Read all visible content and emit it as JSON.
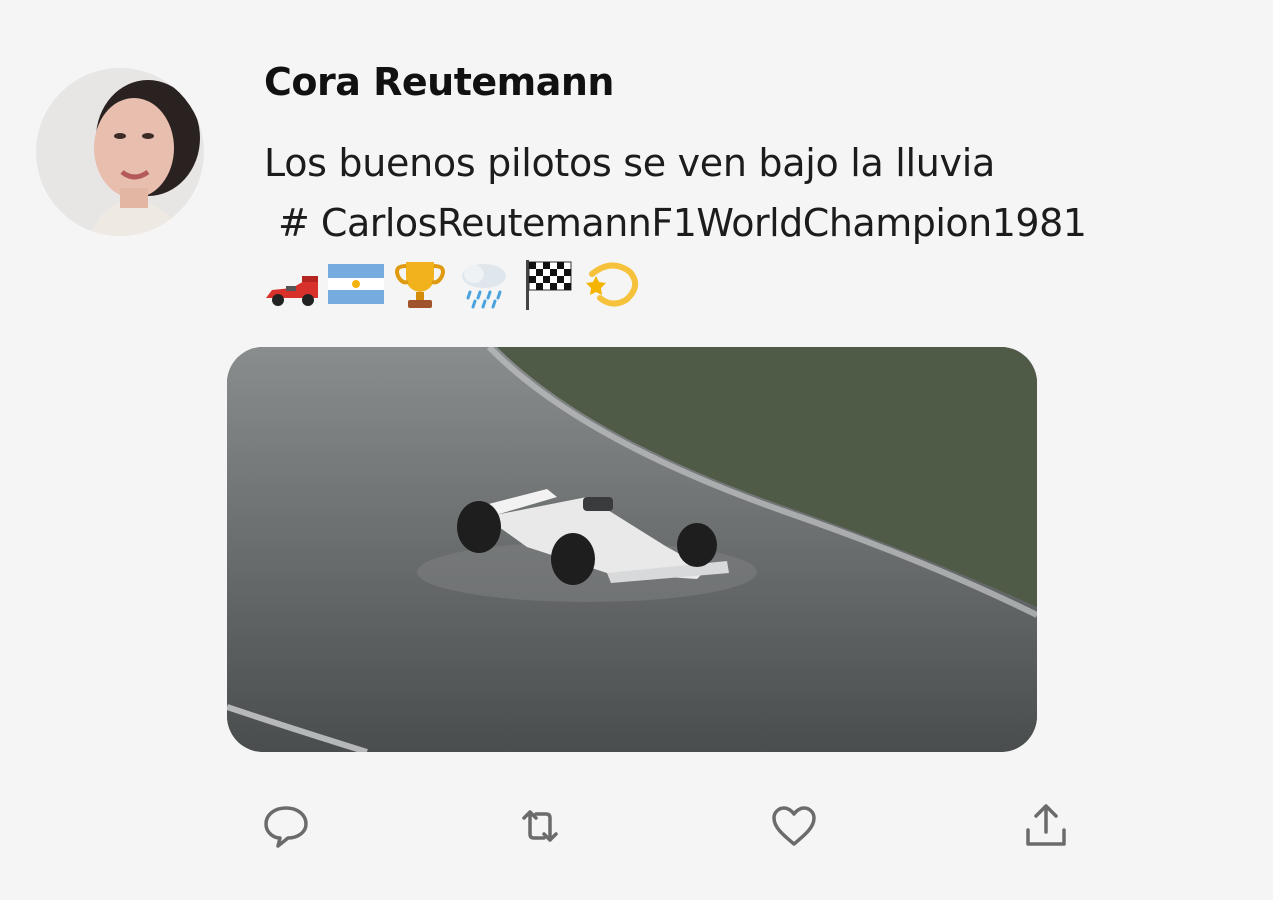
{
  "post": {
    "author": "Cora Reutemann",
    "text": "Los buenos pilotos se ven bajo la lluvia",
    "hashtag": "# CarlosReutemannF1WorldChampion1981",
    "emojis": [
      "racing-car-icon",
      "argentina-flag-icon",
      "trophy-icon",
      "rain-cloud-icon",
      "checkered-flag-icon",
      "dizzy-star-icon"
    ]
  },
  "media": {
    "description_icon": "f1-car-in-rain-video"
  },
  "actions": {
    "icons": [
      "reply-icon",
      "retweet-icon",
      "like-icon",
      "share-icon"
    ]
  },
  "colors": {
    "background": "#f5f5f5",
    "text": "#1c1c1c",
    "icon": "#6b6b6b"
  }
}
